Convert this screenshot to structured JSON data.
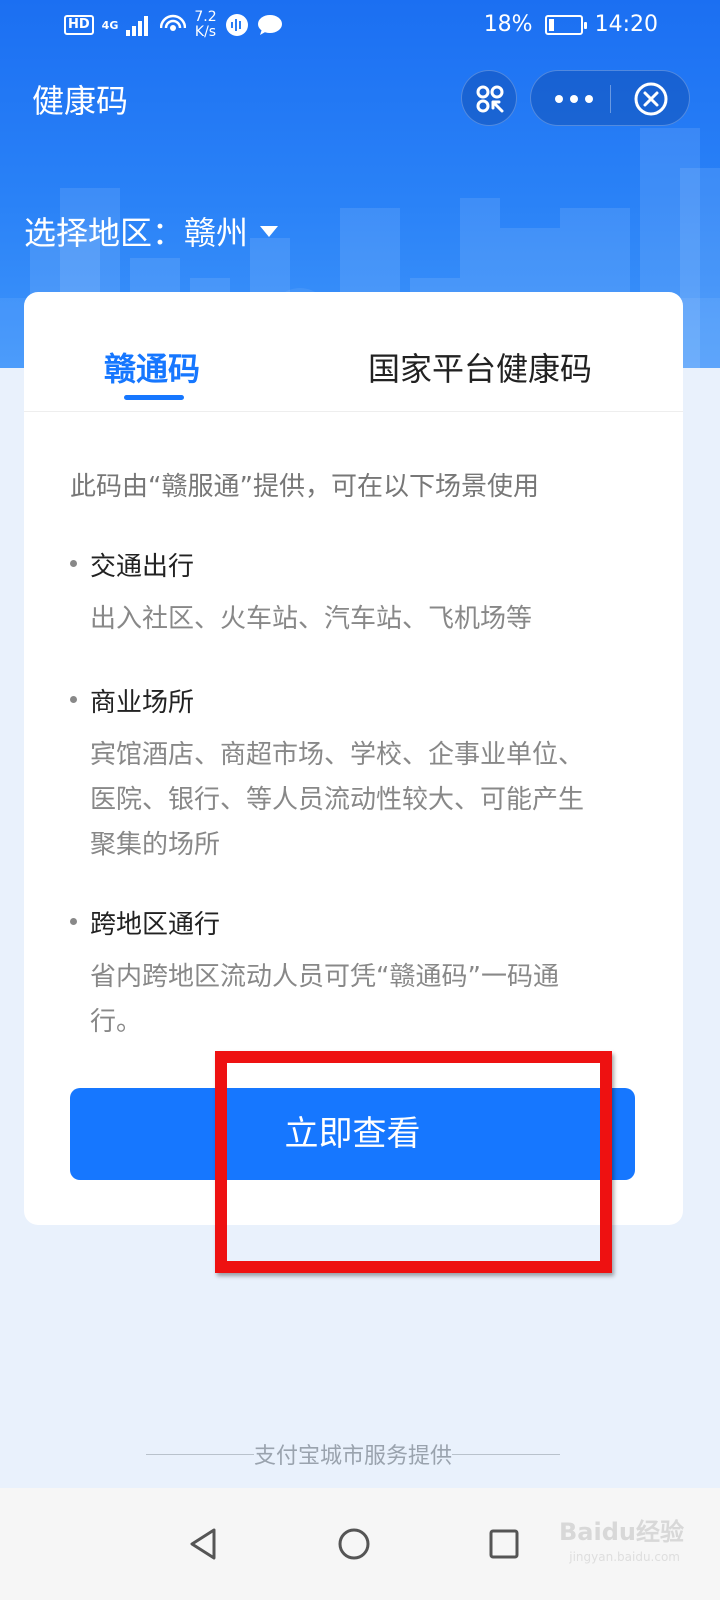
{
  "status_bar": {
    "hd": "HD",
    "network": "4G",
    "speed_value": "7.2",
    "speed_unit": "K/s",
    "battery_percent": "18%",
    "battery_level": 0.18,
    "time": "14:20"
  },
  "header": {
    "title": "健康码",
    "scan_icon": "scan-qr-icon",
    "more_icon": "more-dots-icon",
    "close_icon": "close-circle-icon"
  },
  "region": {
    "label": "选择地区：",
    "value": "赣州"
  },
  "tabs": [
    {
      "label": "赣通码",
      "active": true
    },
    {
      "label": "国家平台健康码",
      "active": false
    }
  ],
  "intro": "此码由“赣服通”提供，可在以下场景使用",
  "sections": [
    {
      "title": "交通出行",
      "desc_lines": [
        "出入社区、火车站、汽车站、飞机场等"
      ]
    },
    {
      "title": "商业场所",
      "desc_lines": [
        "宾馆酒店、商超市场、学校、企事业单位、",
        "医院、银行、等人员流动性较大、可能产生",
        "聚集的场所"
      ]
    },
    {
      "title": "跨地区通行",
      "desc_lines": [
        "省内跨地区流动人员可凭“赣通码”一码通",
        "行。"
      ]
    }
  ],
  "cta_label": "立即查看",
  "footer": "支付宝城市服务提供",
  "nav": {
    "back_icon": "back-triangle-icon",
    "home_icon": "home-circle-icon",
    "recents_icon": "recents-square-icon"
  },
  "watermark": {
    "text": "Baidu经验",
    "sub": "jingyan.baidu.com"
  },
  "colors": {
    "primary": "#1677ff",
    "header_blue": "#1b6ff2",
    "highlight": "#ee1111",
    "background": "#e9f1fc"
  }
}
